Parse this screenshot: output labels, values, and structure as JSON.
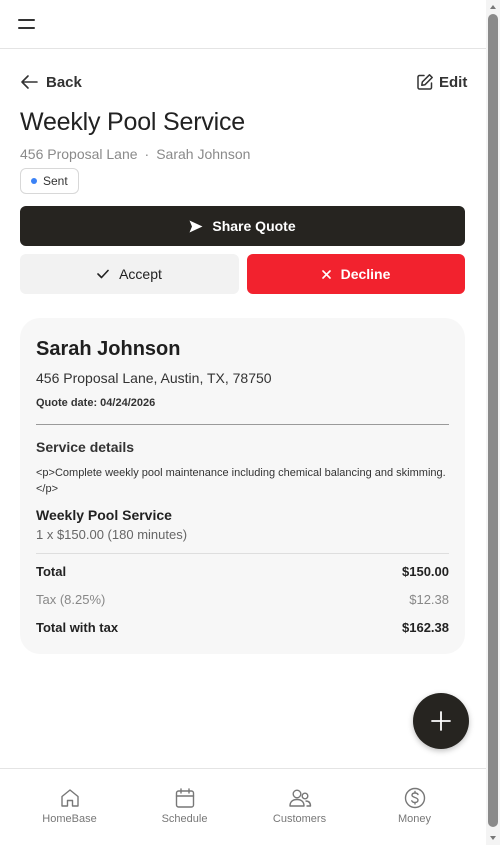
{
  "header": {
    "menu_icon": "hamburger-icon"
  },
  "nav": {
    "back_label": "Back",
    "edit_label": "Edit"
  },
  "quote": {
    "title": "Weekly Pool Service",
    "address_short": "456 Proposal Lane",
    "separator": "·",
    "customer_short": "Sarah Johnson",
    "status": "Sent",
    "status_color": "#3b82f6"
  },
  "actions": {
    "share_label": "Share Quote",
    "accept_label": "Accept",
    "decline_label": "Decline",
    "share_color": "#262420",
    "decline_color": "#f2222e"
  },
  "card": {
    "customer_name": "Sarah Johnson",
    "address": "456 Proposal Lane, Austin, TX, 78750",
    "quote_date": "Quote date: 04/24/2026",
    "service_heading": "Service details",
    "service_description": "<p>Complete weekly pool maintenance including chemical balancing and skimming.</p>",
    "item_name": "Weekly Pool Service",
    "item_detail": "1 x $150.00 (180 minutes)",
    "total_label": "Total",
    "total_value": "$150.00",
    "tax_label": "Tax (8.25%)",
    "tax_value": "$12.38",
    "total_with_tax_label": "Total with tax",
    "total_with_tax_value": "$162.38"
  },
  "bottom_nav": {
    "items": [
      {
        "label": "HomeBase",
        "icon": "home-icon"
      },
      {
        "label": "Schedule",
        "icon": "calendar-icon"
      },
      {
        "label": "Customers",
        "icon": "users-icon"
      },
      {
        "label": "Money",
        "icon": "dollar-icon"
      }
    ]
  }
}
